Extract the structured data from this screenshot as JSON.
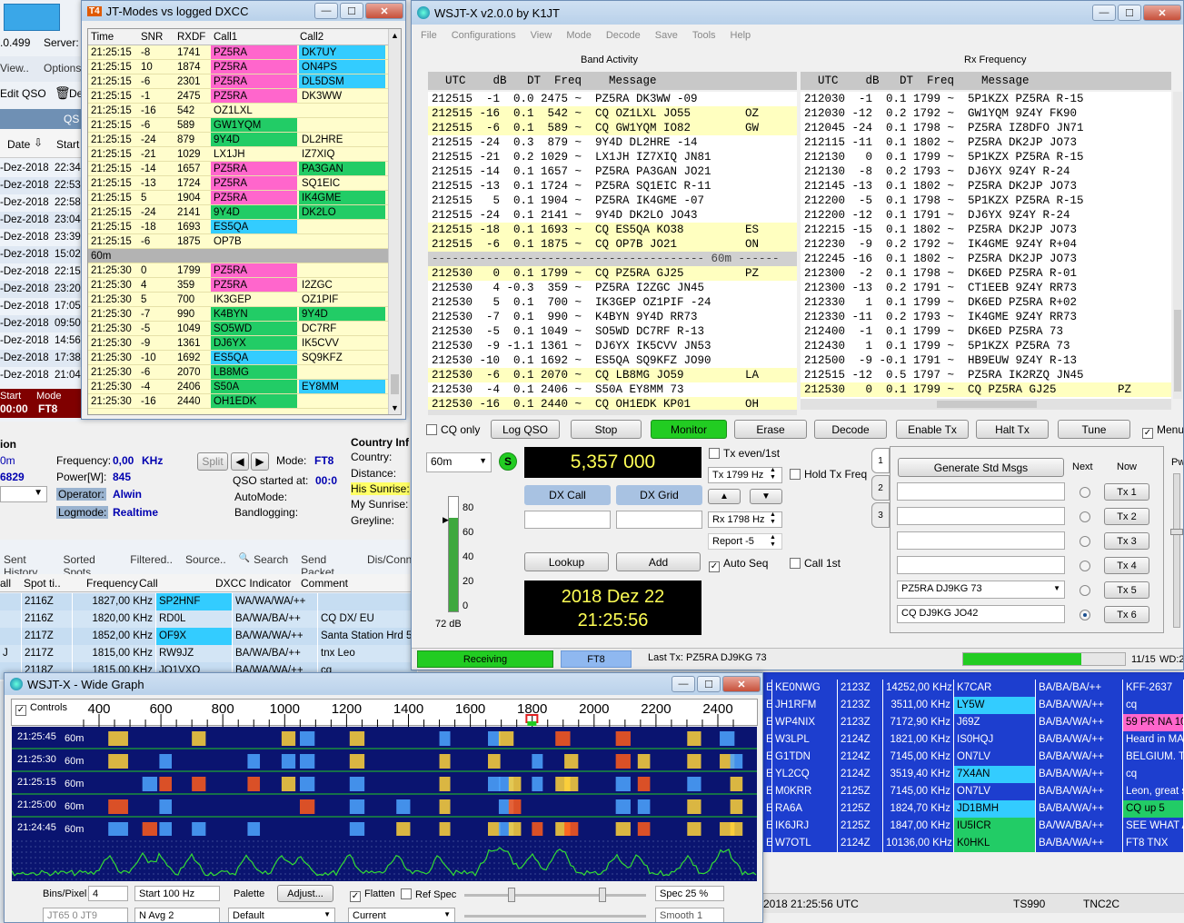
{
  "colors": {
    "pink": "#ff66cc",
    "cyan": "#33ccff",
    "green": "#22cc66",
    "yellowRow": "#fffdcc",
    "cqRow": "#ffffc0",
    "rowBlue": "#1d3ecf",
    "monitor": "#22cc22"
  },
  "bg_logger": {
    "version": ".0.499",
    "server_label": "Server:",
    "menu": [
      "View..",
      "Options"
    ],
    "edit_qso": "Edit QSO",
    "del_label": "De",
    "date_header": "Date",
    "start_header": "Start",
    "qso_label": "QS",
    "dates": [
      "-Dez-2018",
      "-Dez-2018",
      "-Dez-2018",
      "-Dez-2018",
      "-Dez-2018",
      "-Dez-2018",
      "-Dez-2018",
      "-Dez-2018",
      "-Dez-2018",
      "-Dez-2018",
      "-Dez-2018",
      "-Dez-2018",
      "-Dez-2018"
    ],
    "starts": [
      "22:34",
      "22:53",
      "22:58",
      "23:04",
      "23:39",
      "15:02",
      "22:15",
      "23:20",
      "17:05",
      "09:50",
      "14:56",
      "17:38",
      "21:04"
    ],
    "status_start_label": "Start",
    "status_mode_label": "Mode",
    "status_time": "00:00",
    "status_mode": "FT8",
    "info_title": "ion",
    "freq_label": "Frequency:",
    "freq_value": "0,00",
    "freq_unit": "KHz",
    "split": "Split",
    "mode_label": "Mode:",
    "mode_value": "FT8",
    "power_label": "Power[W]:",
    "power_value": "845",
    "left_val1": "0m",
    "left_val2": "6829",
    "qso_started": "QSO started at:",
    "qso_started_val": "00:0",
    "operator_label": "Operator:",
    "operator_value": "Alwin",
    "automode": "AutoMode:",
    "logmode_label": "Logmode:",
    "logmode_value": "Realtime",
    "bandlogging": "Bandlogging:",
    "country_title": "Country Inf",
    "country_label": "Country:",
    "distance_label": "Distance:",
    "his_sunrise": "His Sunrise:",
    "my_sunrise": "My Sunrise:",
    "greyline": "Greyline:"
  },
  "spots": {
    "tabs": [
      "Sent History",
      "Sorted Spots..",
      "Filtered..",
      "Source..",
      "Search",
      "Send Packet..",
      "Dis/Conne"
    ],
    "headers": [
      "all",
      "Spot ti..",
      "Frequency",
      "Call",
      "DXCC Indicator",
      "Comment"
    ],
    "rows": [
      {
        "a": "",
        "t": "2116Z",
        "f": "1827,00 KHz",
        "c": "SP2HNF",
        "ccol": "cyan",
        "d": "WA/WA/WA/++",
        "m": ""
      },
      {
        "a": "",
        "t": "2116Z",
        "f": "1820,00 KHz",
        "c": "RD0L",
        "ccol": "",
        "d": "BA/WA/BA/++",
        "m": "CQ DX/ EU"
      },
      {
        "a": "",
        "t": "2117Z",
        "f": "1852,00 KHz",
        "c": "OF9X",
        "ccol": "cyan",
        "d": "BA/WA/WA/++",
        "m": "Santa Station Hrd 59+"
      },
      {
        "a": "J",
        "t": "2117Z",
        "f": "1815,00 KHz",
        "c": "RW9JZ",
        "ccol": "",
        "d": "BA/WA/BA/++",
        "m": "tnx Leo"
      },
      {
        "a": "",
        "t": "2118Z",
        "f": "1815,00 KHz",
        "c": "JQ1VXQ",
        "ccol": "",
        "d": "BA/WA/WA/++",
        "m": "cq"
      }
    ],
    "right_rows": [
      {
        "e": "E",
        "c": "KE0NWG",
        "t": "2123Z",
        "f": "14252,00 KHz",
        "k": "K7CAR",
        "kcol": "",
        "d": "BA/BA/BA/++",
        "m": "KFF-2637",
        "mcol": ""
      },
      {
        "e": "E",
        "c": "JH1RFM",
        "t": "2123Z",
        "f": "3511,00 KHz",
        "k": "LY5W",
        "kcol": "cyan",
        "d": "BA/BA/WA/++",
        "m": "cq",
        "mcol": ""
      },
      {
        "e": "E",
        "c": "WP4NIX",
        "t": "2123Z",
        "f": "7172,90 KHz",
        "k": "J69Z",
        "kcol": "",
        "d": "BA/BA/WA/++",
        "m": "59 PR NA 108",
        "mcol": "pink"
      },
      {
        "e": "E",
        "c": "W3LPL",
        "t": "2124Z",
        "f": "1821,00 KHz",
        "k": "IS0HQJ",
        "kcol": "",
        "d": "BA/BA/WA/++",
        "m": "Heard in MA",
        "mcol": ""
      },
      {
        "e": "E",
        "c": "G1TDN",
        "t": "2124Z",
        "f": "7145,00 KHz",
        "k": "ON7LV",
        "kcol": "",
        "d": "BA/BA/WA/++",
        "m": "BELGIUM. TNX",
        "mcol": ""
      },
      {
        "e": "E",
        "c": "YL2CQ",
        "t": "2124Z",
        "f": "3519,40 KHz",
        "k": "7X4AN",
        "kcol": "cyan",
        "d": "BA/BA/WA/++",
        "m": "cq",
        "mcol": ""
      },
      {
        "e": "E",
        "c": "M0KRR",
        "t": "2125Z",
        "f": "7145,00 KHz",
        "k": "ON7LV",
        "kcol": "",
        "d": "BA/BA/WA/++",
        "m": "Leon, great sign",
        "mcol": ""
      },
      {
        "e": "E",
        "c": "RA6A",
        "t": "2125Z",
        "f": "1824,70 KHz",
        "k": "JD1BMH",
        "kcol": "cyan",
        "d": "BA/BA/WA/++",
        "m": "CQ up 5",
        "mcol": "green"
      },
      {
        "e": "E",
        "c": "IK6JRJ",
        "t": "2125Z",
        "f": "1847,00 KHz",
        "k": "IU5ICR",
        "kcol": "green",
        "d": "BA/WA/BA/++",
        "m": "SEE WHAT A G",
        "mcol": ""
      },
      {
        "e": "E",
        "c": "W7OTL",
        "t": "2124Z",
        "f": "10136,00 KHz",
        "k": "K0HKL",
        "kcol": "green",
        "d": "BA/BA/WA/++",
        "m": "FT8 TNX",
        "mcol": ""
      }
    ],
    "status": [
      "2018  21:25:56 UTC",
      "TS990",
      "TNC2C"
    ]
  },
  "dxcc": {
    "title": "JT-Modes vs logged DXCC",
    "headers": [
      "Time",
      "SNR",
      "RXDF",
      "Call1",
      "Call2"
    ],
    "rows": [
      [
        "21:25:15",
        "-8",
        "1741",
        "PZ5RA",
        "pink",
        "DK7UY",
        "cyan"
      ],
      [
        "21:25:15",
        "10",
        "1874",
        "PZ5RA",
        "pink",
        "ON4PS",
        "cyan"
      ],
      [
        "21:25:15",
        "-6",
        "2301",
        "PZ5RA",
        "pink",
        "DL5DSM",
        "cyan"
      ],
      [
        "21:25:15",
        "-1",
        "2475",
        "PZ5RA",
        "pink",
        "DK3WW",
        ""
      ],
      [
        "21:25:15",
        "-16",
        "542",
        "OZ1LXL",
        "",
        "",
        " "
      ],
      [
        "21:25:15",
        "-6",
        "589",
        "GW1YQM",
        "green",
        "",
        ""
      ],
      [
        "21:25:15",
        "-24",
        "879",
        "9Y4D",
        "green",
        "DL2HRE",
        ""
      ],
      [
        "21:25:15",
        "-21",
        "1029",
        "LX1JH",
        "",
        "IZ7XIQ",
        ""
      ],
      [
        "21:25:15",
        "-14",
        "1657",
        "PZ5RA",
        "pink",
        "PA3GAN",
        "green"
      ],
      [
        "21:25:15",
        "-13",
        "1724",
        "PZ5RA",
        "pink",
        "SQ1EIC",
        ""
      ],
      [
        "21:25:15",
        "5",
        "1904",
        "PZ5RA",
        "pink",
        "IK4GME",
        "green"
      ],
      [
        "21:25:15",
        "-24",
        "2141",
        "9Y4D",
        "green",
        "DK2LO",
        "green"
      ],
      [
        "21:25:15",
        "-18",
        "1693",
        "ES5QA",
        "cyan",
        "",
        ""
      ],
      [
        "21:25:15",
        "-6",
        "1875",
        "OP7B",
        "",
        "",
        ""
      ],
      [
        "60m",
        "",
        "",
        "",
        "",
        "",
        ""
      ],
      [
        "21:25:30",
        "0",
        "1799",
        "PZ5RA",
        "pink",
        "",
        ""
      ],
      [
        "21:25:30",
        "4",
        "359",
        "PZ5RA",
        "pink",
        "I2ZGC",
        ""
      ],
      [
        "21:25:30",
        "5",
        "700",
        "IK3GEP",
        "",
        "OZ1PIF",
        ""
      ],
      [
        "21:25:30",
        "-7",
        "990",
        "K4BYN",
        "green",
        "9Y4D",
        "green"
      ],
      [
        "21:25:30",
        "-5",
        "1049",
        "SO5WD",
        "green",
        "DC7RF",
        ""
      ],
      [
        "21:25:30",
        "-9",
        "1361",
        "DJ6YX",
        "green",
        "IK5CVV",
        ""
      ],
      [
        "21:25:30",
        "-10",
        "1692",
        "ES5QA",
        "cyan",
        "SQ9KFZ",
        ""
      ],
      [
        "21:25:30",
        "-6",
        "2070",
        "LB8MG",
        "green",
        "",
        ""
      ],
      [
        "21:25:30",
        "-4",
        "2406",
        "S50A",
        "green",
        "EY8MM",
        "cyan"
      ],
      [
        "21:25:30",
        "-16",
        "2440",
        "OH1EDK",
        "green",
        "",
        ""
      ]
    ]
  },
  "wsjtx": {
    "title": "WSJT-X   v2.0.0   by K1JT",
    "menu": [
      "File",
      "Configurations",
      "View",
      "Mode",
      "Decode",
      "Save",
      "Tools",
      "Help"
    ],
    "band_activity": "Band Activity",
    "rx_frequency": "Rx Frequency",
    "col_header": "  UTC    dB   DT  Freq    Message",
    "band_lines": [
      {
        "t": "212515  -1  0.0 2475 ~  PZ5RA DK3WW -09",
        "k": ""
      },
      {
        "t": "212515 -16  0.1  542 ~  CQ OZ1LXL JO55        OZ",
        "k": "cq"
      },
      {
        "t": "212515  -6  0.1  589 ~  CQ GW1YQM IO82        GW",
        "k": "cq"
      },
      {
        "t": "212515 -24  0.3  879 ~  9Y4D DL2HRE -14",
        "k": ""
      },
      {
        "t": "212515 -21  0.2 1029 ~  LX1JH IZ7XIQ JN81",
        "k": ""
      },
      {
        "t": "212515 -14  0.1 1657 ~  PZ5RA PA3GAN JO21",
        "k": ""
      },
      {
        "t": "212515 -13  0.1 1724 ~  PZ5RA SQ1EIC R-11",
        "k": ""
      },
      {
        "t": "212515   5  0.1 1904 ~  PZ5RA IK4GME -07",
        "k": ""
      },
      {
        "t": "212515 -24  0.1 2141 ~  9Y4D DK2LO JO43",
        "k": ""
      },
      {
        "t": "212515 -18  0.1 1693 ~  CQ ES5QA KO38         ES",
        "k": "cq"
      },
      {
        "t": "212515  -6  0.1 1875 ~  CQ OP7B JO21          ON",
        "k": "cq"
      },
      {
        "t": "---------------------------------------- 60m ------",
        "k": "sep"
      },
      {
        "t": "212530   0  0.1 1799 ~  CQ PZ5RA GJ25         PZ",
        "k": "cq"
      },
      {
        "t": "212530   4 -0.3  359 ~  PZ5RA I2ZGC JN45",
        "k": ""
      },
      {
        "t": "212530   5  0.1  700 ~  IK3GEP OZ1PIF -24",
        "k": ""
      },
      {
        "t": "212530  -7  0.1  990 ~  K4BYN 9Y4D RR73",
        "k": ""
      },
      {
        "t": "212530  -5  0.1 1049 ~  SO5WD DC7RF R-13",
        "k": ""
      },
      {
        "t": "212530  -9 -1.1 1361 ~  DJ6YX IK5CVV JN53",
        "k": ""
      },
      {
        "t": "212530 -10  0.1 1692 ~  ES5QA SQ9KFZ JO90",
        "k": ""
      },
      {
        "t": "212530  -6  0.1 2070 ~  CQ LB8MG JO59         LA",
        "k": "cq"
      },
      {
        "t": "212530  -4  0.1 2406 ~  S50A EY8MM 73",
        "k": ""
      },
      {
        "t": "212530 -16  0.1 2440 ~  CQ OH1EDK KP01        OH",
        "k": "cq"
      }
    ],
    "rx_lines": [
      {
        "t": "212030  -1  0.1 1799 ~  5P1KZX PZ5RA R-15",
        "k": ""
      },
      {
        "t": "212030 -12  0.2 1792 ~  GW1YQM 9Z4Y FK90",
        "k": ""
      },
      {
        "t": "212045 -24  0.1 1798 ~  PZ5RA IZ8DFO JN71",
        "k": ""
      },
      {
        "t": "212115 -11  0.1 1802 ~  PZ5RA DK2JP JO73",
        "k": ""
      },
      {
        "t": "212130   0  0.1 1799 ~  5P1KZX PZ5RA R-15",
        "k": ""
      },
      {
        "t": "212130  -8  0.2 1793 ~  DJ6YX 9Z4Y R-24",
        "k": ""
      },
      {
        "t": "212145 -13  0.1 1802 ~  PZ5RA DK2JP JO73",
        "k": ""
      },
      {
        "t": "212200  -5  0.1 1798 ~  5P1KZX PZ5RA R-15",
        "k": ""
      },
      {
        "t": "212200 -12  0.1 1791 ~  DJ6YX 9Z4Y R-24",
        "k": ""
      },
      {
        "t": "212215 -15  0.1 1802 ~  PZ5RA DK2JP JO73",
        "k": ""
      },
      {
        "t": "212230  -9  0.2 1792 ~  IK4GME 9Z4Y R+04",
        "k": ""
      },
      {
        "t": "212245 -16  0.1 1802 ~  PZ5RA DK2JP JO73",
        "k": ""
      },
      {
        "t": "212300  -2  0.1 1798 ~  DK6ED PZ5RA R-01",
        "k": ""
      },
      {
        "t": "212300 -13  0.2 1791 ~  CT1EEB 9Z4Y RR73",
        "k": ""
      },
      {
        "t": "212330   1  0.1 1799 ~  DK6ED PZ5RA R+02",
        "k": ""
      },
      {
        "t": "212330 -11  0.2 1793 ~  IK4GME 9Z4Y RR73",
        "k": ""
      },
      {
        "t": "212400  -1  0.1 1799 ~  DK6ED PZ5RA 73",
        "k": ""
      },
      {
        "t": "212430   1  0.1 1799 ~  5P1KZX PZ5RA 73",
        "k": ""
      },
      {
        "t": "212500  -9 -0.1 1791 ~  HB9EUW 9Z4Y R-13",
        "k": ""
      },
      {
        "t": "212515 -12  0.5 1797 ~  PZ5RA IK2RZQ JN45",
        "k": ""
      },
      {
        "t": "212530   0  0.1 1799 ~  CQ PZ5RA GJ25         PZ",
        "k": "cq"
      }
    ],
    "buttons": {
      "cq_only": "CQ only",
      "log_qso": "Log QSO",
      "stop": "Stop",
      "monitor": "Monitor",
      "erase": "Erase",
      "decode": "Decode",
      "enable_tx": "Enable Tx",
      "halt_tx": "Halt Tx",
      "tune": "Tune",
      "menus": "Menus"
    },
    "band": "60m",
    "s_meter_label": "S",
    "dial_freq": "5,357 000",
    "tx_even": "Tx even/1st",
    "tx_freq_label": "Tx",
    "tx_freq": "1799",
    "hz": "Hz",
    "hold_tx": "Hold Tx Freq",
    "rx_freq_label": "Rx",
    "rx_freq": "1798",
    "report": "Report -5",
    "auto_seq": "Auto Seq",
    "call_1st": "Call 1st",
    "dx_call": "DX Call",
    "dx_grid": "DX Grid",
    "lookup": "Lookup",
    "add": "Add",
    "date": "2018 Dez 22",
    "time": "21:25:56",
    "meter_ticks": [
      "80",
      "60",
      "40",
      "20",
      "0"
    ],
    "meter_db": "72 dB",
    "gen_std": "Generate Std Msgs",
    "next": "Next",
    "now": "Now",
    "tx_msgs": [
      "",
      "",
      "",
      "",
      "PZ5RA DJ9KG 73",
      "CQ DJ9KG JO42"
    ],
    "tx_labels": [
      "Tx 1",
      "Tx 2",
      "Tx 3",
      "Tx 4",
      "Tx 5",
      "Tx 6"
    ],
    "tabs": [
      "1",
      "2",
      "3"
    ],
    "status": {
      "receiving": "Receiving",
      "mode": "FT8",
      "last_tx": "Last Tx: PZ5RA DJ9KG 73",
      "period": "11/15",
      "wd": "WD:2m",
      "period_progress": 0.73
    },
    "pwr_label": "Pwr"
  },
  "wide": {
    "title": "WSJT-X - Wide Graph",
    "controls": "Controls",
    "scale": [
      "400",
      "600",
      "800",
      "1000",
      "1200",
      "1400",
      "1600",
      "1800",
      "2000",
      "2200",
      "2400"
    ],
    "times": [
      {
        "t": "21:25:45",
        "b": "60m"
      },
      {
        "t": "21:25:30",
        "b": "60m"
      },
      {
        "t": "21:25:15",
        "b": "60m"
      },
      {
        "t": "21:25:00",
        "b": "60m"
      },
      {
        "t": "21:24:45",
        "b": "60m"
      }
    ],
    "bins_label": "Bins/Pixel",
    "bins": "4",
    "start_label": "Start",
    "start": "100 Hz",
    "palette": "Palette",
    "adjust": "Adjust...",
    "flatten": "Flatten",
    "ref_spec": "Ref Spec",
    "spec": "Spec 25 %",
    "mode_sel": "JT65 0 JT9",
    "navg": "N Avg 2",
    "default": "Default",
    "current": "Current",
    "smooth": "Smooth  1"
  }
}
